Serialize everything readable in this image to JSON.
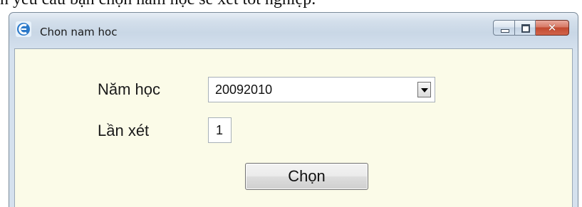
{
  "caption": "n yêu cầu bạn chọn năm học sẽ xét tốt nghiệp.",
  "window": {
    "title": "Chon nam hoc",
    "icon": "app-logo-icon",
    "controls": [
      "minimize-icon",
      "maximize-icon",
      "close-icon"
    ]
  },
  "form": {
    "year_label": "Năm học",
    "year_value": "20092010",
    "round_label": "Lần xét",
    "round_value": "1",
    "choose_label": "Chọn"
  }
}
